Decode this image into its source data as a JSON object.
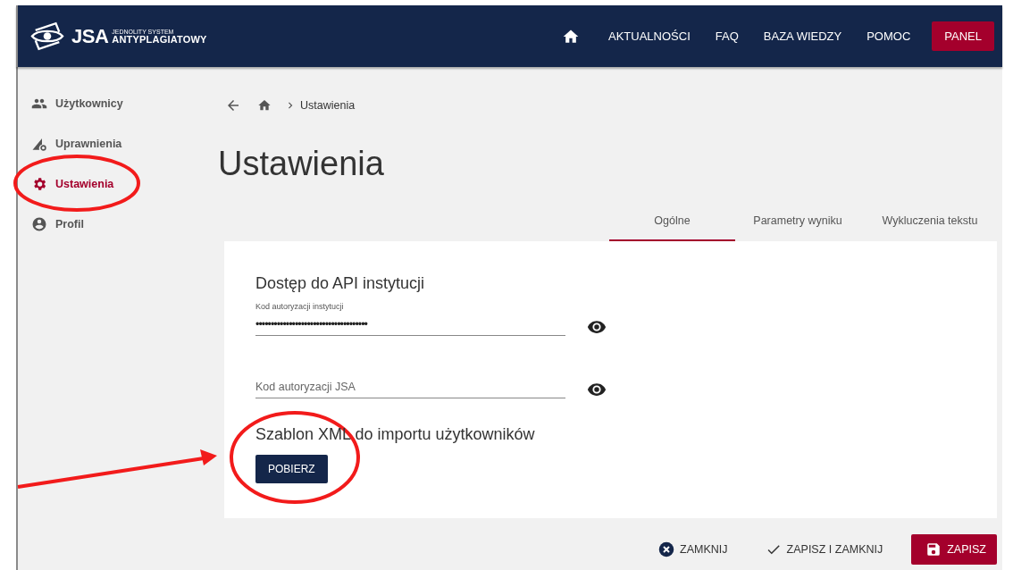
{
  "header": {
    "logo": {
      "title": "JSA",
      "subtitle_top": "JEDNOLITY SYSTEM",
      "subtitle_bottom": "ANTYPLAGIATOWY"
    },
    "nav": [
      {
        "label": "AKTUALNOŚCI"
      },
      {
        "label": "FAQ"
      },
      {
        "label": "BAZA WIEDZY"
      },
      {
        "label": "POMOC"
      }
    ],
    "panel_button": "PANEL"
  },
  "sidebar": {
    "items": [
      {
        "label": "Użytkownicy",
        "selected": false
      },
      {
        "label": "Uprawnienia",
        "selected": false
      },
      {
        "label": "Ustawienia",
        "selected": true
      },
      {
        "label": "Profil",
        "selected": false
      }
    ]
  },
  "breadcrumb": {
    "current": "Ustawienia"
  },
  "page_title": "Ustawienia",
  "tabs": [
    {
      "label": "Ogólne",
      "selected": true
    },
    {
      "label": "Parametry wyniku",
      "selected": false
    },
    {
      "label": "Wykluczenia tekstu",
      "selected": false
    }
  ],
  "card": {
    "sections": [
      {
        "heading": "Dostęp do API instytucji",
        "fields": [
          {
            "label": "Kod autoryzacji instytucji",
            "value": "•••••••••••••••••••••••••••••••••••••"
          },
          {
            "placeholder": "Kod autoryzacji JSA"
          }
        ]
      },
      {
        "heading": "Szablon XML do importu użytkowników",
        "button": "POBIERZ"
      }
    ]
  },
  "footer_buttons": [
    {
      "label": "ZAMKNIJ",
      "kind": "close"
    },
    {
      "label": "ZAPISZ I ZAMKNIJ",
      "kind": "check"
    },
    {
      "label": "ZAPISZ",
      "kind": "save"
    }
  ],
  "annotations": [
    {
      "kind": "ellipse"
    },
    {
      "kind": "ellipse"
    },
    {
      "kind": "arrow"
    }
  ]
}
